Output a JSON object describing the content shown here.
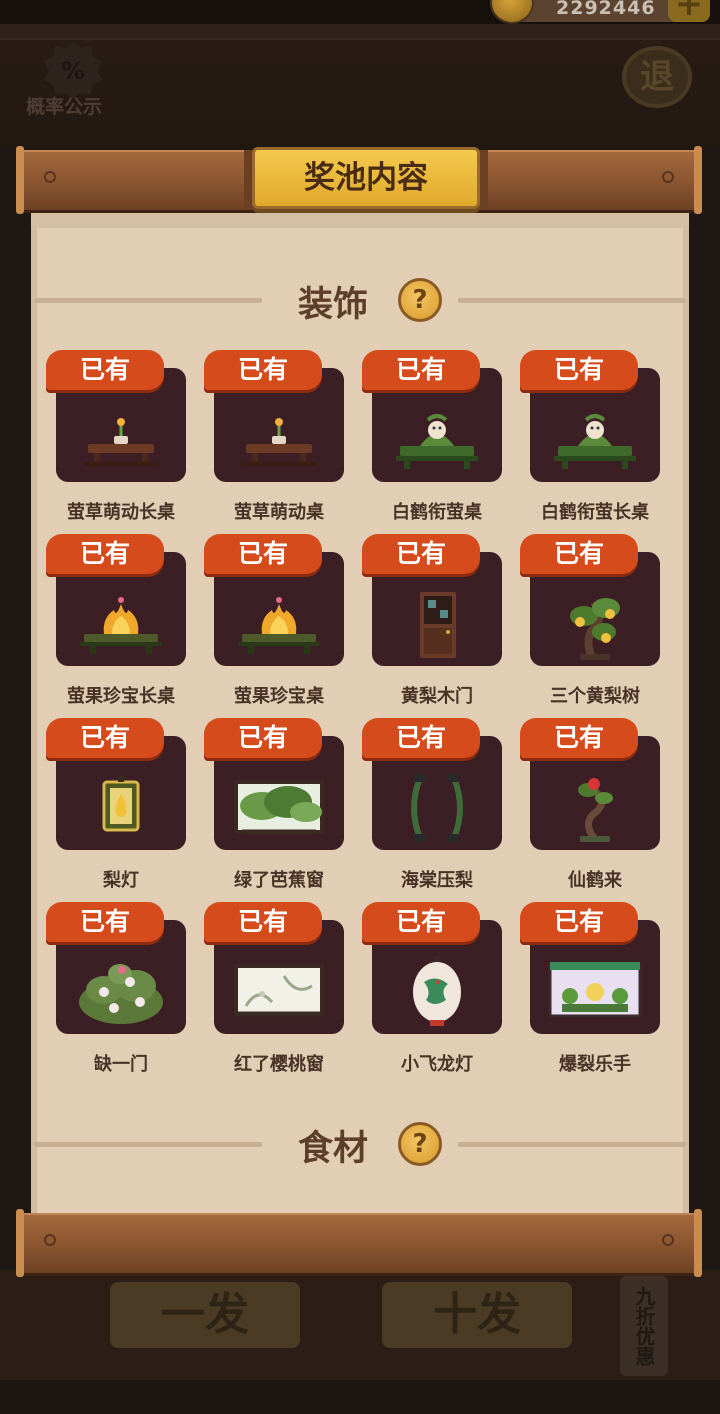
{
  "header": {
    "coins": "2292446",
    "add_label": "+",
    "probability_label": "概率公示",
    "probability_symbol": "%",
    "exit_label": "退"
  },
  "panel": {
    "title": "奖池内容",
    "sections": [
      {
        "title": "装饰",
        "help": "?"
      },
      {
        "title": "食材",
        "help": "?"
      }
    ],
    "owned_badge": "已有",
    "items": [
      {
        "name": "萤草萌动长桌",
        "icon": "low-table-sprout-icon"
      },
      {
        "name": "萤草萌动桌",
        "icon": "low-table-sprout-icon"
      },
      {
        "name": "白鹤衔萤桌",
        "icon": "crane-table-icon"
      },
      {
        "name": "白鹤衔萤长桌",
        "icon": "crane-table-icon"
      },
      {
        "name": "萤果珍宝长桌",
        "icon": "fire-fruit-table-icon"
      },
      {
        "name": "萤果珍宝桌",
        "icon": "fire-fruit-table-icon"
      },
      {
        "name": "黄梨木门",
        "icon": "wooden-door-icon"
      },
      {
        "name": "三个黄梨树",
        "icon": "pear-tree-icon"
      },
      {
        "name": "梨灯",
        "icon": "pear-lamp-icon"
      },
      {
        "name": "绿了芭蕉窗",
        "icon": "banana-leaf-window-icon"
      },
      {
        "name": "海棠压梨",
        "icon": "arch-frame-icon"
      },
      {
        "name": "仙鹤来",
        "icon": "bonsai-flower-icon"
      },
      {
        "name": "缺一门",
        "icon": "flower-bush-icon"
      },
      {
        "name": "红了樱桃窗",
        "icon": "cherry-window-icon"
      },
      {
        "name": "小飞龙灯",
        "icon": "dragon-lantern-icon"
      },
      {
        "name": "爆裂乐手",
        "icon": "band-stage-icon"
      }
    ]
  },
  "background_buttons": {
    "single_draw": "一发",
    "ten_draw": "十发",
    "discount_tag": "九折优惠"
  }
}
